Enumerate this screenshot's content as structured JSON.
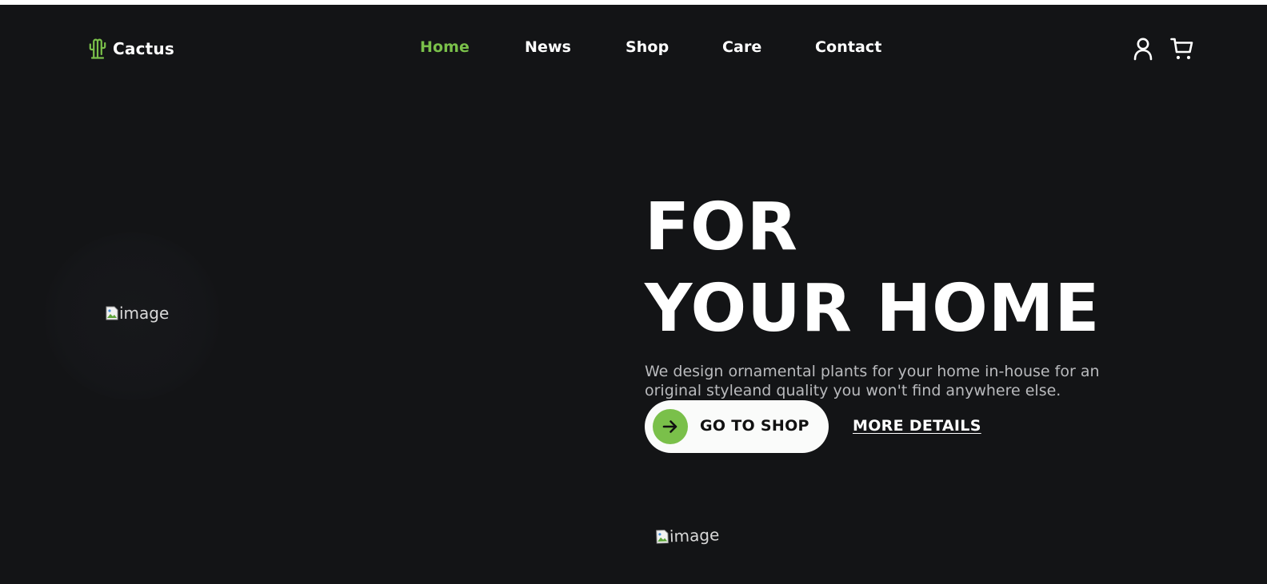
{
  "brand": {
    "name": "Cactus",
    "accent_color": "#7ac04a",
    "icon": "cactus-icon"
  },
  "nav": {
    "items": [
      {
        "label": "Home",
        "active": true
      },
      {
        "label": "News",
        "active": false
      },
      {
        "label": "Shop",
        "active": false
      },
      {
        "label": "Care",
        "active": false
      },
      {
        "label": "Contact",
        "active": false
      }
    ]
  },
  "header_actions": {
    "account_icon": "user-icon",
    "cart_icon": "cart-icon"
  },
  "hero": {
    "title_line1": "FOR",
    "title_line2": "YOUR HOME",
    "description": "We design ornamental plants for your home in-house for an original styleand quality you won't find anywhere else.",
    "primary_button": {
      "label": "GO TO SHOP",
      "icon": "arrow-right-icon"
    },
    "secondary_link": {
      "label": "MORE DETAILS"
    },
    "image_alt": "image",
    "bottom_image_alt": "image"
  },
  "colors": {
    "background": "#131416",
    "text": "#ffffff",
    "muted_text": "#b9babd",
    "button_bg": "#fafbfa"
  }
}
